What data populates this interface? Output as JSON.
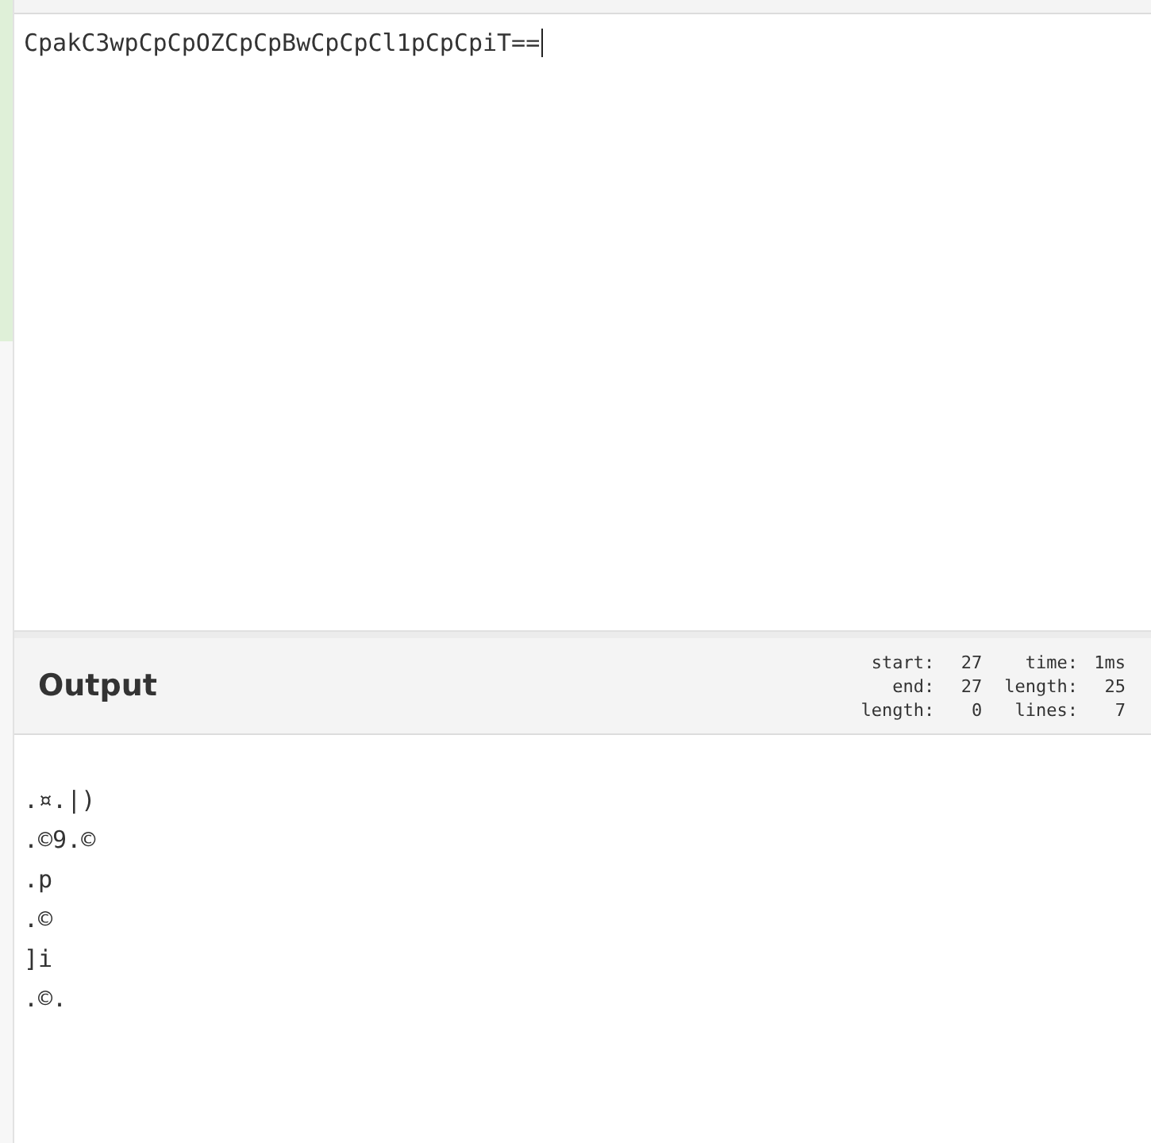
{
  "input": {
    "value": "CpakC3wpCpCpOZCpCpBwCpCpCl1pCpCpiT=="
  },
  "output": {
    "title": "Output",
    "stats": [
      {
        "label": "start:",
        "value": "27"
      },
      {
        "label": "time:",
        "value": "1ms"
      },
      {
        "label": "end:",
        "value": "27"
      },
      {
        "label": "length:",
        "value": "25"
      },
      {
        "label": "length:",
        "value": "0"
      },
      {
        "label": "lines:",
        "value": "7"
      }
    ],
    "lines": [
      ".¤.|)",
      ".©9.©",
      ".p",
      ".©",
      "]i",
      ".©."
    ]
  }
}
